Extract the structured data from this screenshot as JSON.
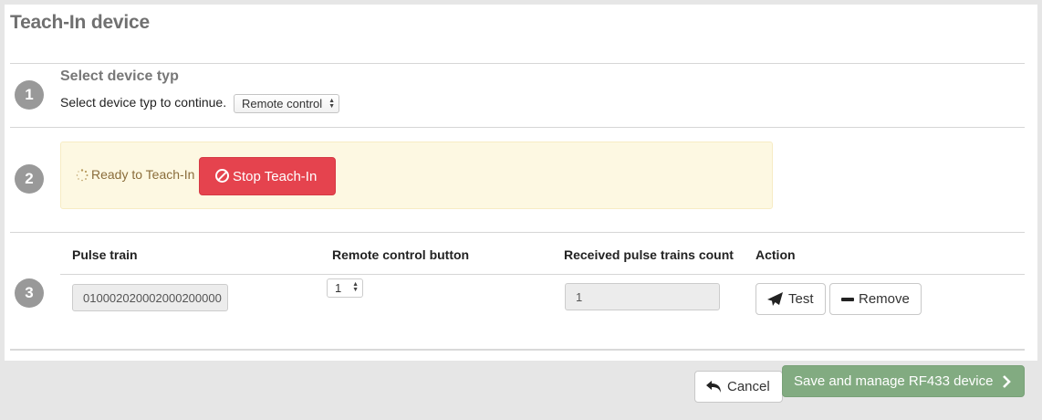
{
  "header": {
    "title": "Teach-In device"
  },
  "step1": {
    "number": "1",
    "title": "Select device typ",
    "label": "Select device typ to continue.",
    "select_value": "Remote control"
  },
  "step2": {
    "number": "2",
    "status_text": "Ready to Teach-In",
    "stop_button": "Stop Teach-In"
  },
  "step3": {
    "number": "3",
    "columns": [
      "Pulse train",
      "Remote control button",
      "Received pulse trains count",
      "Action"
    ],
    "row": {
      "pulse_train": "010002020002000200000",
      "button_value": "1",
      "count": "1",
      "test_label": "Test",
      "remove_label": "Remove"
    }
  },
  "footer": {
    "cancel_label": "Cancel",
    "save_label": "Save and manage RF433 device"
  },
  "colors": {
    "danger": "#e5434e",
    "warning_bg": "#fdf8e2",
    "success_muted": "#82ab81",
    "step_badge": "#999999"
  },
  "icons": [
    "loading-spinner-icon",
    "ban-icon",
    "paper-plane-icon",
    "minus-icon",
    "undo-icon",
    "chevron-right-icon",
    "select-arrows-icon"
  ]
}
